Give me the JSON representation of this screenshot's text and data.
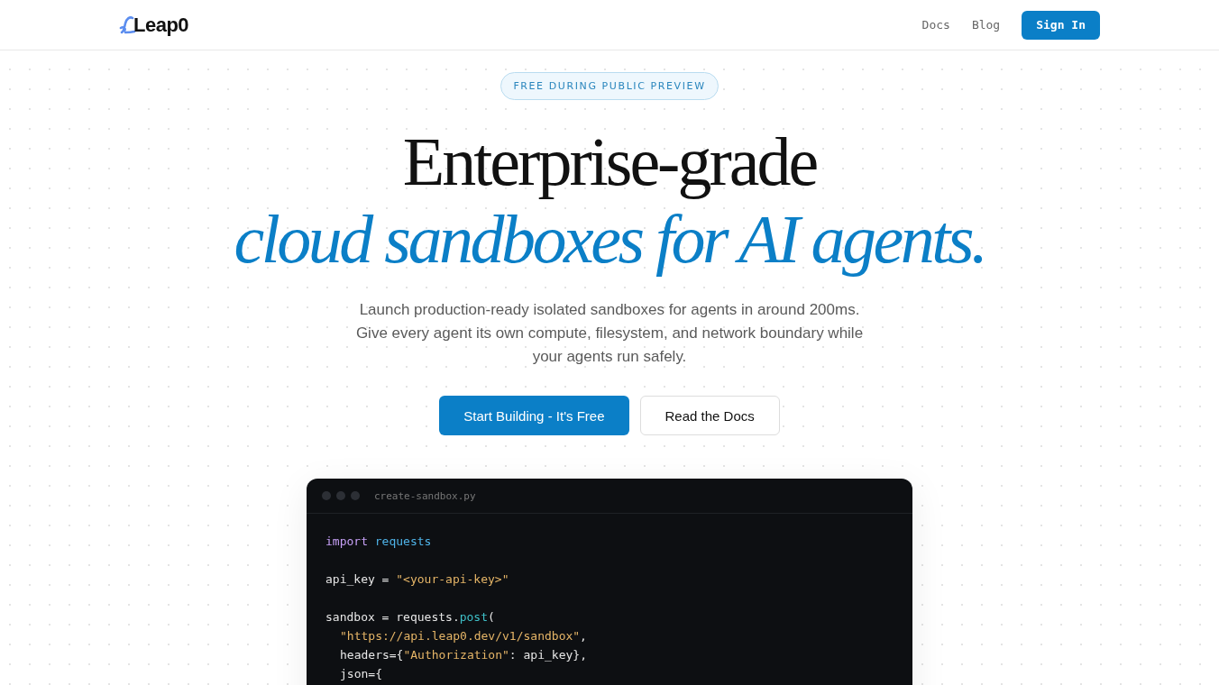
{
  "nav": {
    "logo": "Leap0",
    "links": [
      {
        "label": "Docs"
      },
      {
        "label": "Blog"
      }
    ],
    "button": "Sign In"
  },
  "hero": {
    "badge": "FREE DURING PUBLIC PREVIEW",
    "title_line_1": "Enterprise-grade",
    "title_line_2": "cloud sandboxes for AI agents.",
    "description": "Launch production-ready isolated sandboxes for agents in around 200ms. Give every agent its own compute, filesystem, and network boundary while your agents run safely.",
    "buttons": [
      {
        "label": "Start Building - It's Free",
        "kind": "primary"
      },
      {
        "label": "Read the Docs",
        "kind": "secondary"
      }
    ]
  },
  "code_window": {
    "filename": "create-sandbox.py",
    "lines": [
      {
        "blank_before": false,
        "indent": false,
        "tokens": [
          {
            "kind": "keyword",
            "text": "import"
          },
          {
            "kind": "module",
            "text": "requests"
          }
        ]
      },
      {
        "blank_before": true,
        "indent": false,
        "tokens": [
          {
            "kind": "plain",
            "text": "api_key = "
          },
          {
            "kind": "string",
            "text": "\"<your-api-key>\""
          }
        ]
      },
      {
        "blank_before": true,
        "indent": false,
        "tokens": [
          {
            "kind": "plain",
            "text": "sandbox = requests."
          },
          {
            "kind": "func",
            "text": "post"
          },
          {
            "kind": "plain",
            "text": "("
          }
        ]
      },
      {
        "blank_before": false,
        "indent": true,
        "tokens": [
          {
            "kind": "string",
            "text": "\"https://api.leap0.dev/v1/sandbox\""
          },
          {
            "kind": "plain",
            "text": ","
          }
        ]
      },
      {
        "blank_before": false,
        "indent": true,
        "tokens": [
          {
            "kind": "plain",
            "text": "headers={"
          },
          {
            "kind": "string",
            "text": "\"Authorization\""
          },
          {
            "kind": "plain",
            "text": ": api_key},"
          }
        ]
      },
      {
        "blank_before": false,
        "indent": true,
        "tokens": [
          {
            "kind": "plain",
            "text": "json={"
          }
        ]
      }
    ]
  }
}
